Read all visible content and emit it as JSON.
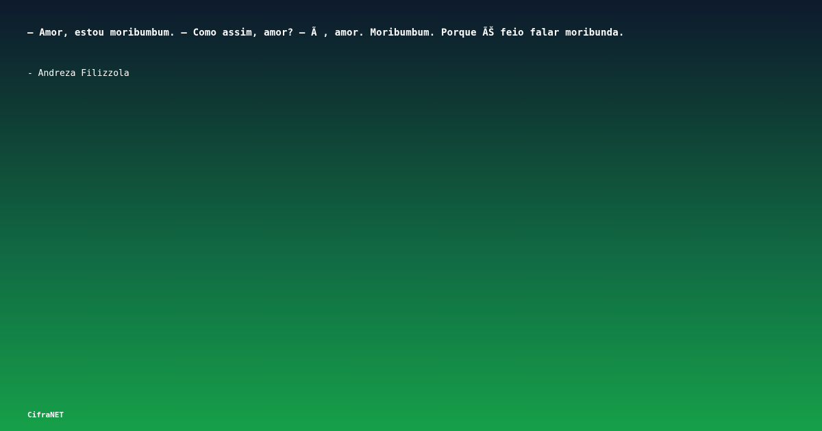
{
  "quote": {
    "text": "– Amor, estou moribumbum. – Como assim, amor? – Ã , amor. Moribumbum. Porque ÃŠ feio falar moribunda."
  },
  "author": {
    "text": "- Andreza Filizzola"
  },
  "brand": {
    "name": "CifraNET"
  },
  "colors": {
    "top": "#0e1a2d",
    "bottom": "#16a049",
    "text": "#ffffff"
  }
}
